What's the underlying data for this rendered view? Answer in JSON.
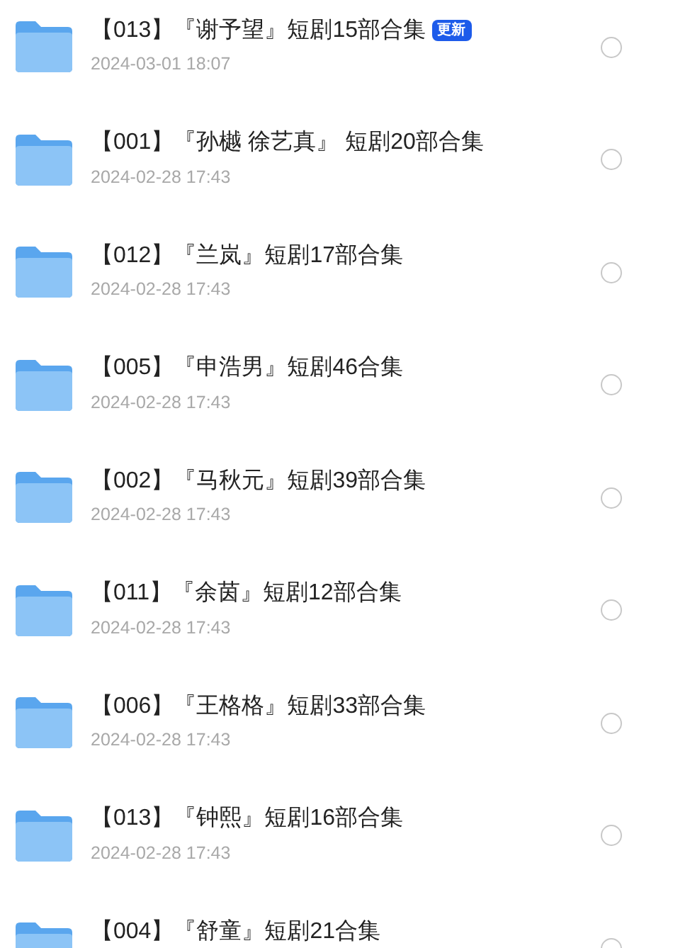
{
  "items": [
    {
      "title": "【013】『谢予望』短剧15部合集",
      "badge": "更新",
      "date": "2024-03-01 18:07",
      "selected": false
    },
    {
      "title": "【001】『孙樾 徐艺真』 短剧20部合集",
      "date": "2024-02-28 17:43",
      "selected": false
    },
    {
      "title": "【012】『兰岚』短剧17部合集",
      "date": "2024-02-28 17:43",
      "selected": false
    },
    {
      "title": "【005】『申浩男』短剧46合集",
      "date": "2024-02-28 17:43",
      "selected": false
    },
    {
      "title": "【002】『马秋元』短剧39部合集",
      "date": "2024-02-28 17:43",
      "selected": false
    },
    {
      "title": "【011】『余茵』短剧12部合集",
      "date": "2024-02-28 17:43",
      "selected": false
    },
    {
      "title": "【006】『王格格』短剧33部合集",
      "date": "2024-02-28 17:43",
      "selected": false
    },
    {
      "title": "【013】『钟熙』短剧16部合集",
      "date": "2024-02-28 17:43",
      "selected": false
    },
    {
      "title": "【004】『舒童』短剧21合集",
      "selected": false
    }
  ]
}
